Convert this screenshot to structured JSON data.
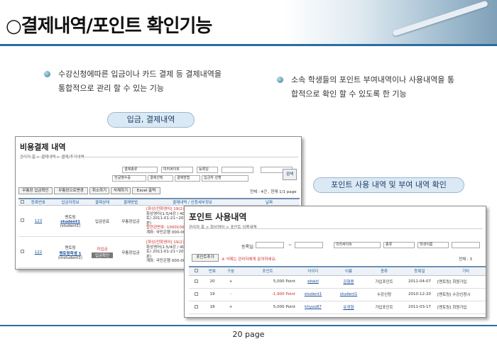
{
  "header": {
    "title": "○결제내역/포인트 확인기능"
  },
  "bullets": {
    "left": [
      "수강신청에따른 입금이나 카드 결제 등 결제내역을",
      "통합적으로 관리 할 수 있는 기능"
    ],
    "right": [
      "소속 학생들의 포인트 부여내역이나 사용내역을 통",
      "합적으로 확인 할 수 있도록 한 기능"
    ]
  },
  "pills": {
    "payment": "입금, 결제내역",
    "points": "포인트 사용 내역 및 부여 내역 확인"
  },
  "shot1": {
    "title": "비용결제 내역",
    "breadcrumb": "관리자 홈 > 결제내역 > 결제/추가내역",
    "filters": [
      "결제종류",
      "미러싸이트",
      "등록일",
      "한글영수증",
      "결제선택",
      "결제방법",
      "입금자 성명"
    ],
    "search_button": "검색",
    "buttons": [
      "무통장 입금확인",
      "무통장으로변경",
      "취소하기",
      "삭제하기",
      "Excel 출력"
    ],
    "count_text": "전체 : 4건 , 현재 1/1 page",
    "columns": [
      "등록번호",
      "입금자정보",
      "결제상태",
      "결제방법",
      "결제내역 / 신청세부정보",
      "날짜"
    ],
    "rows": [
      {
        "no": "123",
        "site": "멘토링",
        "user": "student1",
        "userid": "(student1)",
        "status": "입금완료",
        "method": "무통장입금",
        "detail": [
          "[화상/전화영어] 19(2건)",
          "화상영어(1:5/4강 / 4D",
          "토) 2011-01-21~2011-0",
          "분)",
          "합연관변호: 1000100",
          "계좌: 국민은행 000-00-"
        ]
      },
      {
        "no": "122",
        "site": "멘토링",
        "user": "멘토링학생 1",
        "userid": "(mstudent1)",
        "status": "미입금",
        "status2": "입금확인",
        "method": "무통장입금",
        "detail": [
          "[화상/전화영어] 19(2건)",
          "화상영어(1:5/4강 / 4D",
          "토) 2011-01-21~2011-0",
          "분)",
          "계좌: 국민은행 000-00-0"
        ]
      }
    ]
  },
  "shot2": {
    "title": "포인트 사용내역",
    "breadcrumb": "관리자 홈 > 화상영어 > 포인트 이용내역",
    "filter_label": "등록일:",
    "filters": [
      "미러싸이트",
      "종류",
      "학생이름"
    ],
    "add_button": "포인트추가",
    "notice": "※ 삭제는 관리자에게 문의하세요.",
    "count_text": "전체 : 3",
    "columns": [
      "번호",
      "구분",
      "포인트",
      "아이디",
      "이름",
      "종류",
      "등록일",
      "기타"
    ],
    "rows": [
      {
        "no": "20",
        "type": "+",
        "point": "5,000 Point",
        "id": "ekaizl",
        "name": "김형용",
        "kind": "가입포인트",
        "date": "2011-04-07",
        "etc": "[멘토링] 회원가입"
      },
      {
        "no": "19",
        "type": "-",
        "point": "-1,900 Point",
        "id": "student1",
        "name": "student1",
        "kind": "수강신청",
        "date": "2010-12-20",
        "etc": "[멘토링] 수강신청시"
      },
      {
        "no": "18",
        "type": "+",
        "point": "5,000 Point",
        "id": "khyoo87",
        "name": "유경향",
        "kind": "가입포인트",
        "date": "2011-03-17",
        "etc": "[멘토링] 회원가입"
      }
    ]
  },
  "footer": {
    "page": "20 page"
  },
  "colors": {
    "accent": "#2c6d9e",
    "link": "#1d4f9a",
    "negative": "#cc2a2a"
  }
}
